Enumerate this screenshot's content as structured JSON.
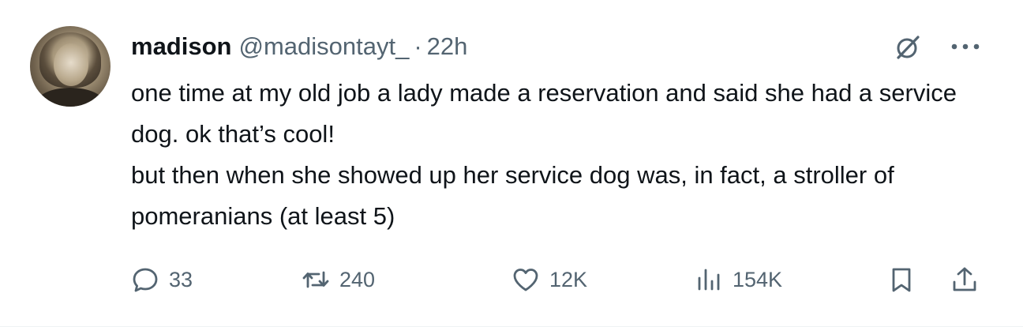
{
  "tweet": {
    "author_name": "madison",
    "handle": "@madisontayt_",
    "separator": "·",
    "time": "22h",
    "paragraphs": [
      "one time at my old job a lady made a reservation and said she had a service dog. ok that’s cool!",
      "but then when she showed up her service dog was, in fact, a stroller of pomeranians (at least 5)"
    ]
  },
  "actions": {
    "replies": "33",
    "reposts": "240",
    "likes": "12K",
    "views": "154K"
  },
  "icons": {
    "avatar": "profile-photo",
    "grok": "grok-icon",
    "more": "more-icon",
    "reply": "reply-icon",
    "repost": "repost-icon",
    "like": "heart-icon",
    "views": "views-icon",
    "bookmark": "bookmark-icon",
    "share": "share-icon"
  },
  "colors": {
    "text": "#0f1419",
    "secondary": "#536471"
  }
}
